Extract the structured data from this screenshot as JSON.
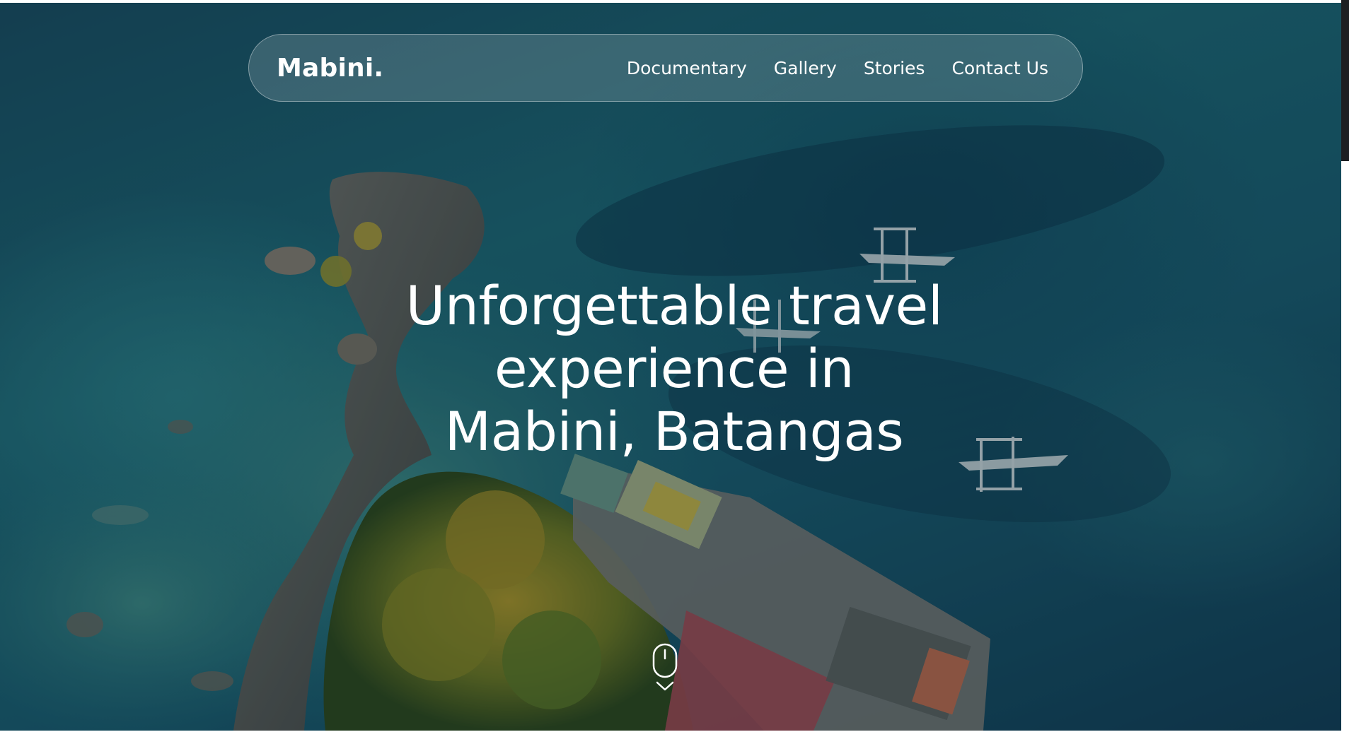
{
  "site": {
    "brand": "Mabini."
  },
  "nav": {
    "items": [
      {
        "label": "Documentary"
      },
      {
        "label": "Gallery"
      },
      {
        "label": "Stories"
      },
      {
        "label": "Contact Us"
      }
    ]
  },
  "hero": {
    "headline_lines": [
      "Unforgettable travel",
      "experience in",
      "Mabini, Batangas"
    ],
    "background_description_icon": "aerial-island-photo",
    "scroll_icon": "mouse-scroll-down-icon"
  },
  "colors": {
    "text": "#ffffff",
    "sea_dark": "#123f58",
    "sea_teal": "#1d6a78",
    "scroll_thumb": "#1d1f22"
  }
}
